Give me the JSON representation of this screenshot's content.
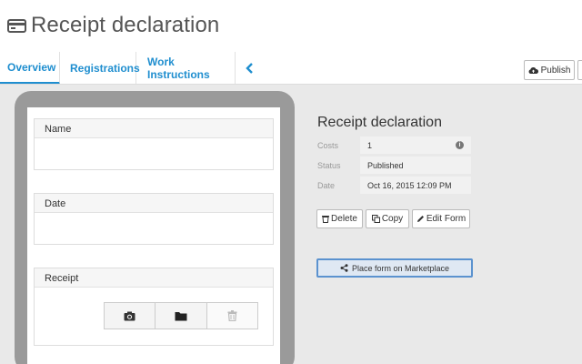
{
  "header": {
    "title": "Receipt declaration",
    "title_icon": "credit-card-icon"
  },
  "tabs": [
    {
      "label": "Overview",
      "active": true
    },
    {
      "label": "Registrations",
      "active": false
    },
    {
      "label": "Work Instructions",
      "active": false
    }
  ],
  "toolbar": {
    "publish_label": "Publish",
    "publish_icon": "cloud-upload-icon"
  },
  "form_preview": {
    "fields": [
      {
        "label": "Name"
      },
      {
        "label": "Date"
      },
      {
        "label": "Receipt",
        "buttons": [
          "camera-icon",
          "folder-icon",
          "trash-icon"
        ]
      }
    ]
  },
  "details": {
    "title": "Receipt declaration",
    "rows": [
      {
        "label": "Costs",
        "value": "1",
        "icon": "info-icon"
      },
      {
        "label": "Status",
        "value": "Published"
      },
      {
        "label": "Date",
        "value": "Oct 16, 2015 12:09 PM"
      }
    ],
    "actions": {
      "delete": "Delete",
      "copy": "Copy",
      "edit": "Edit Form"
    },
    "marketplace_label": "Place form on Marketplace"
  },
  "colors": {
    "accent": "#1f8ecf",
    "marketplace_border": "#5b92cf",
    "device_frame": "#9a9a9a"
  }
}
